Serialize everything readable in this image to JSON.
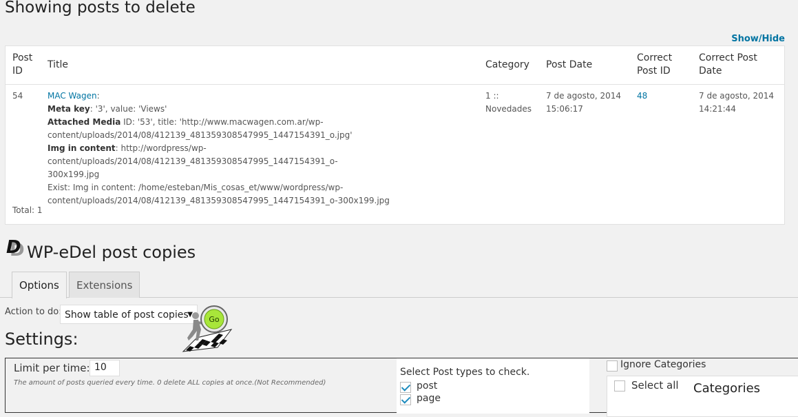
{
  "page": {
    "title": "Showing posts to delete",
    "show_hide_link": "Show/Hide"
  },
  "table": {
    "headers": [
      "Post ID",
      "Title",
      "Category",
      "Post Date",
      "Correct Post ID",
      "Correct Post Date"
    ],
    "headers_display": {
      "post_id_1": "Post",
      "post_id_2": "ID",
      "title": "Title",
      "category": "Category",
      "post_date": "Post Date",
      "correct_id_1": "Correct",
      "correct_id_2": "Post ID",
      "correct_date_1": "Correct Post",
      "correct_date_2": "Date"
    },
    "row": {
      "post_id": "54",
      "title_link": "MAC Wagen",
      "meta_key_label": "Meta key",
      "meta_key_value": ": '3', value: 'Views'",
      "attached_label": "Attached Media",
      "attached_line1": " ID: '53', title: 'http://www.macwagen.com.ar/wp-",
      "attached_line2": "content/uploads/2014/08/412139_481359308547995_1447154391_o.jpg'",
      "img_label": "Img in content",
      "img_line1": ": http://wordpress/wp-content/uploads/2014/08/412139_481359308547995_1447154391_o-",
      "img_line2": "300x199.jpg",
      "exist_line1": "Exist: Img in content: /home/esteban/Mis_cosas_et/www/wordpress/wp-",
      "exist_line2": "content/uploads/2014/08/412139_481359308547995_1447154391_o-300x199.jpg",
      "category_line1": "1 ::",
      "category_line2": "Novedades",
      "post_date_line1": "7 de agosto, 2014",
      "post_date_line2": "15:06:17",
      "correct_post_id": "48",
      "correct_date_line1": "7 de agosto, 2014",
      "correct_date_line2": "14:21:44"
    },
    "total": "Total: 1"
  },
  "plugin": {
    "logo_letter": "D",
    "title": "WP-eDel post copies"
  },
  "tabs": [
    {
      "label": "Options",
      "active": true
    },
    {
      "label": "Extensions",
      "active": false
    }
  ],
  "action": {
    "label": "Action to do:",
    "selected": "Show table of post copies",
    "go_label": "Go"
  },
  "settings": {
    "title": "Settings:",
    "limit_label": "Limit per time:",
    "limit_value": "10",
    "limit_help": "The amount of posts queried every time. 0 delete ALL copies at once.(Not Recommended)",
    "post_types_title": "Select Post types to check.",
    "post_types": [
      {
        "label": "post",
        "checked": true
      },
      {
        "label": "page",
        "checked": true
      }
    ],
    "ignore_categories_label": "Ignore Categories",
    "select_all_label": "Select all",
    "categories_heading": "Categories"
  },
  "colors": {
    "link": "#0074a2",
    "go_button": "#a8e63a",
    "checkbox_check": "#1e8cbe"
  }
}
